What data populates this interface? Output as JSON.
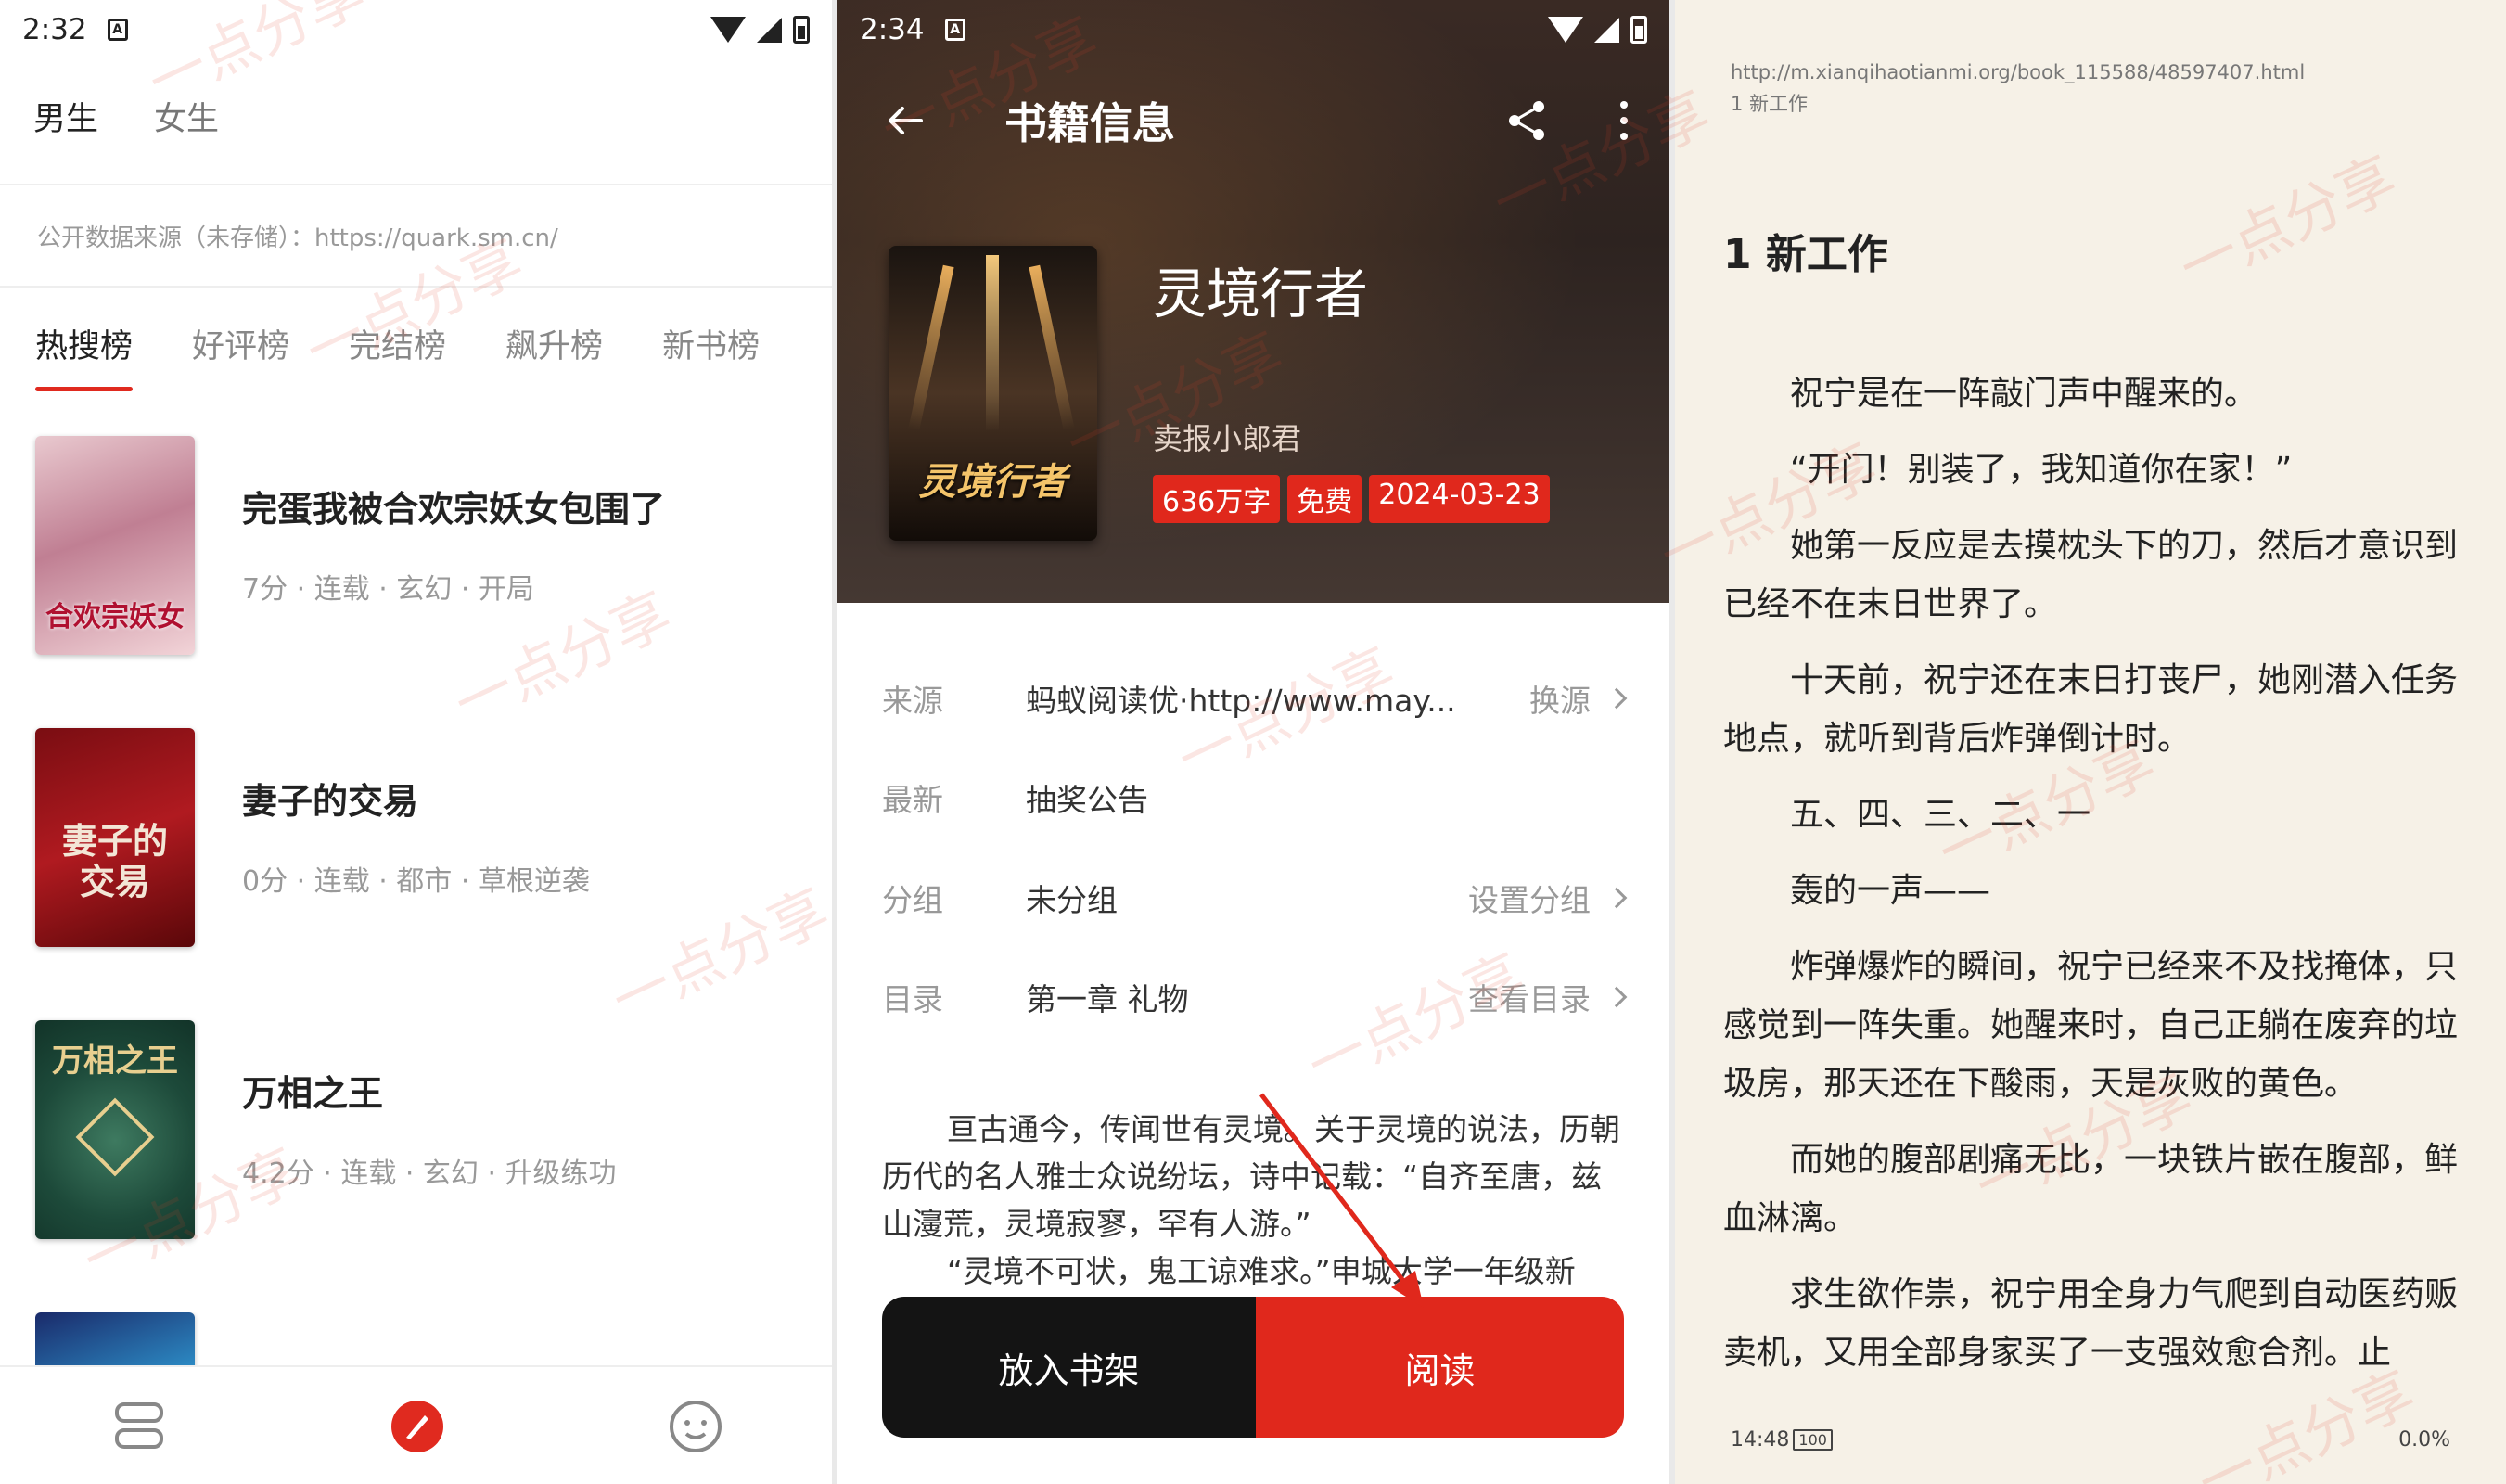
{
  "panel1": {
    "status": {
      "time": "2:32",
      "notif": "A"
    },
    "gender_tabs": [
      "男生",
      "女生"
    ],
    "source_line": "公开数据来源（未存储）：https://quark.sm.cn/",
    "rank_tabs": [
      "热搜榜",
      "好评榜",
      "完结榜",
      "飙升榜",
      "新书榜"
    ],
    "books": [
      {
        "title": "完蛋我被合欢宗妖女包围了",
        "meta": "7分 · 连载 · 玄幻 · 开局",
        "cover_text": "合欢宗妖女"
      },
      {
        "title": "妻子的交易",
        "meta": "0分 · 连载 · 都市 · 草根逆袭",
        "cover_text": "妻子的交易"
      },
      {
        "title": "万相之王",
        "meta": "4.2分 · 连载 · 玄幻 · 升级练功",
        "cover_text": "万相之王"
      }
    ],
    "nav": [
      "bookshelf-icon",
      "discover-icon",
      "profile-icon"
    ],
    "accent": "#e02a1f"
  },
  "panel2": {
    "status": {
      "time": "2:34",
      "notif": "A"
    },
    "header_title": "书籍信息",
    "book": {
      "title": "灵境行者",
      "author": "卖报小郎君",
      "tags": [
        "636万字",
        "免费",
        "2024-03-23"
      ],
      "cover_text": "灵境行者"
    },
    "info": [
      {
        "key": "来源",
        "value": "蚂蚁阅读优·http://www.may...",
        "action": "换源"
      },
      {
        "key": "最新",
        "value": "抽奖公告",
        "action": ""
      },
      {
        "key": "分组",
        "value": "未分组",
        "action": "设置分组"
      },
      {
        "key": "目录",
        "value": "第一章 礼物",
        "action": "查看目录"
      }
    ],
    "intro": [
      "亘古通今，传闻世有灵境。关于灵境的说法，历朝历代的名人雅士众说纷坛，诗中记载：“自齐至唐，兹山濅荒，灵境寂寥，罕有人游。”",
      "“灵境不可状，鬼工谅难求。”申城大学一年级新"
    ],
    "btn_shelf": "放入书架",
    "btn_read": "阅读"
  },
  "panel3": {
    "url": "http://m.xianqihaotianmi.org/book_115588/48597407.html",
    "chapter_small": "1 新工作",
    "chapter_title": "1 新工作",
    "paragraphs": [
      "祝宁是在一阵敲门声中醒来的。",
      "“开门！别装了，我知道你在家！”",
      "她第一反应是去摸枕头下的刀，然后才意识到已经不在末日世界了。",
      "十天前，祝宁还在末日打丧尸，她刚潜入任务地点，就听到背后炸弹倒计时。",
      "五、四、三、二、一",
      "轰的一声——",
      "炸弹爆炸的瞬间，祝宁已经来不及找掩体，只感觉到一阵失重。她醒来时，自己正躺在废弃的垃圾房，那天还在下酸雨，天是灰败的黄色。",
      "而她的腹部剧痛无比，一块铁片嵌在腹部，鲜血淋漓。",
      "求生欲作祟，祝宁用全身力气爬到自动医药贩卖机，又用全部身家买了一支强效愈合剂。止"
    ],
    "footer_time": "14:48",
    "footer_battery": "100",
    "footer_progress": "0.0%"
  },
  "watermark": "一点分享"
}
